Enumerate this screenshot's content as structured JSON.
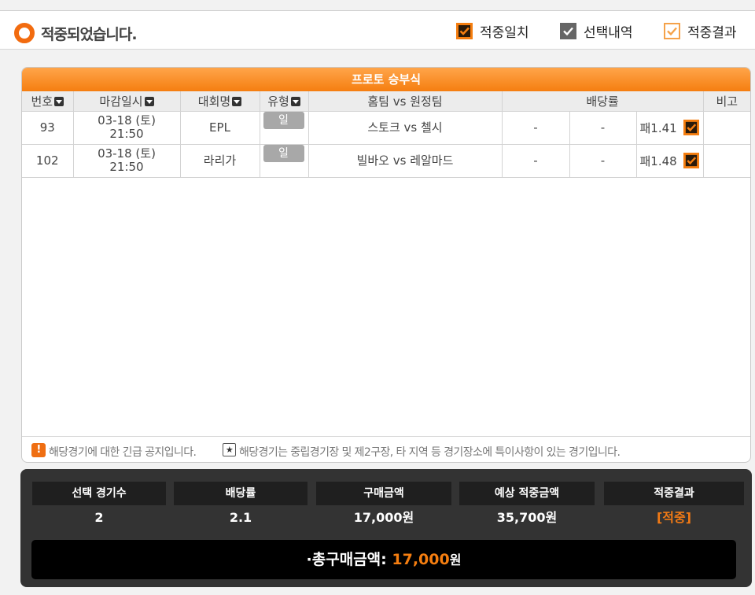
{
  "header": {
    "status_text": "적중되었습니다.",
    "legend": [
      {
        "label": "적중일치",
        "color": "#f57e10",
        "style": "filled-dark-check"
      },
      {
        "label": "선택내역",
        "color": "#666666",
        "style": "gray-check"
      },
      {
        "label": "적중결과",
        "color": "#f5a24a",
        "style": "outline-check"
      }
    ]
  },
  "game_table": {
    "title": "프로토 승부식",
    "columns": [
      "번호",
      "마감일시",
      "대회명",
      "유형",
      "홈팀 vs 원정팀",
      "배당률",
      "비고"
    ],
    "rows": [
      {
        "no": "93",
        "date": "03-18 (토)",
        "time": "21:50",
        "league": "EPL",
        "type": "일 반",
        "match": "스토크 vs 첼시",
        "odds_win": "-",
        "odds_draw": "-",
        "odds_loss": "패1.41",
        "note": ""
      },
      {
        "no": "102",
        "date": "03-18 (토)",
        "time": "21:50",
        "league": "라리가",
        "type": "일 반",
        "match": "빌바오 vs 레알마드",
        "odds_win": "-",
        "odds_draw": "-",
        "odds_loss": "패1.48",
        "note": ""
      }
    ],
    "notice_1": "해당경기에 대한 긴급 공지입니다.",
    "notice_2": "해당경기는 중립경기장 및 제2구장, 타 지역 등 경기장소에 특이사항이 있는 경기입니다."
  },
  "summary": {
    "columns": [
      {
        "label": "선택 경기수",
        "value": "2"
      },
      {
        "label": "배당률",
        "value": "2.1"
      },
      {
        "label": "구매금액",
        "value": "17,000원"
      },
      {
        "label": "예상 적중금액",
        "value": "35,700원"
      },
      {
        "label": "적중결과",
        "value": "[적중]"
      }
    ],
    "total_label": "총구매금액:",
    "total_amount": "17,000",
    "total_unit": "원"
  }
}
